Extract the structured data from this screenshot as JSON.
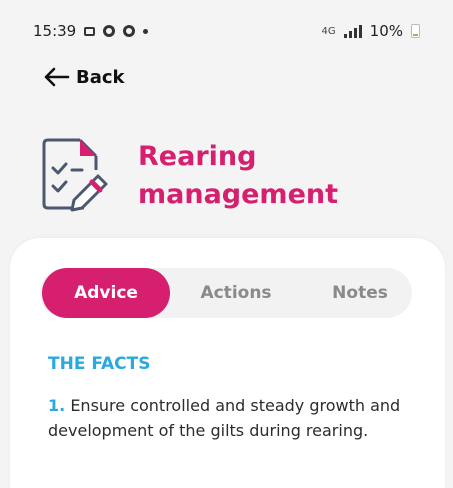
{
  "status_bar": {
    "time": "15:39",
    "battery": "10%",
    "icons": [
      "image-icon",
      "settings-circle-icon",
      "settings-circle-icon",
      "dot-icon",
      "wifi-calling-icon",
      "signal-icon",
      "battery-icon"
    ],
    "network_label": "4G"
  },
  "nav": {
    "back_label": "Back"
  },
  "header": {
    "title_line1": "Rearing",
    "title_line2": "management",
    "icon": "checklist-edit-icon",
    "accent_color": "#d6206f"
  },
  "tabs": [
    {
      "label": "Advice",
      "active": true
    },
    {
      "label": "Actions",
      "active": false
    },
    {
      "label": "Notes",
      "active": false
    }
  ],
  "content": {
    "section_heading": "THE FACTS",
    "facts": [
      {
        "number": "1.",
        "text": "Ensure controlled and steady growth and development of the gilts during rearing."
      }
    ],
    "heading_color": "#2aa9df"
  }
}
